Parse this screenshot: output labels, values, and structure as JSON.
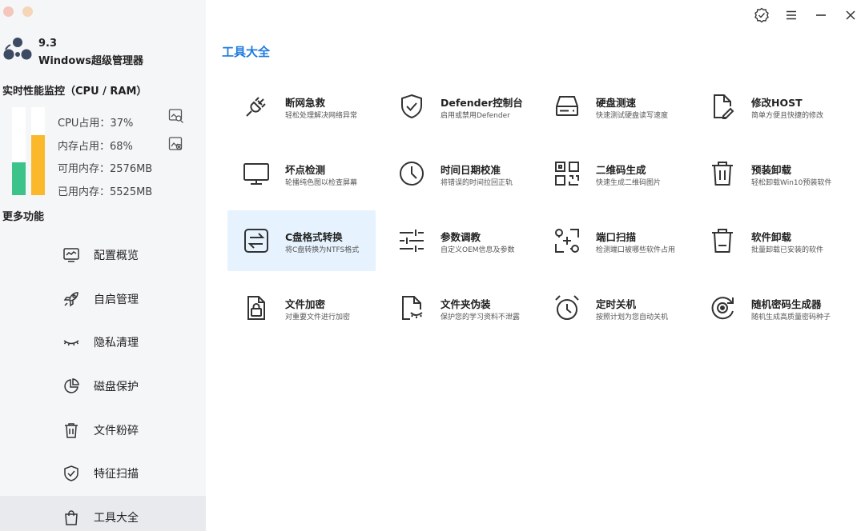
{
  "window": {
    "controls": [
      "verified-icon",
      "menu-icon",
      "minimize-icon",
      "close-icon"
    ]
  },
  "app": {
    "version": "9.3",
    "name": "Windows超级管理器"
  },
  "performance": {
    "title": "实时性能监控（CPU / RAM）",
    "cpu_percent": 37,
    "ram_percent": 68,
    "cpu_label": "CPU占用：37%",
    "ram_label": "内存占用：68%",
    "available_label": "可用内存：2576MB",
    "used_label": "已用内存：5525MB",
    "colors": {
      "cpu": "#3cc38a",
      "ram": "#fbb82a"
    }
  },
  "sidebar": {
    "more_title": "更多功能",
    "items": [
      {
        "label": "配置概览",
        "icon": "monitor-icon"
      },
      {
        "label": "自启管理",
        "icon": "rocket-icon"
      },
      {
        "label": "隐私清理",
        "icon": "eye-closed-icon"
      },
      {
        "label": "磁盘保护",
        "icon": "pie-chart-icon"
      },
      {
        "label": "文件粉碎",
        "icon": "trash-icon"
      },
      {
        "label": "特征扫描",
        "icon": "shield-check-icon"
      },
      {
        "label": "工具大全",
        "icon": "shopping-bag-icon",
        "active": true
      }
    ]
  },
  "main": {
    "title": "工具大全",
    "accent": "#1f7ae0",
    "tools": [
      {
        "title": "断网急救",
        "desc": "轻松处理解决网络异常",
        "icon": "plug-icon"
      },
      {
        "title": "Defender控制台",
        "desc": "启用或禁用Defender",
        "icon": "shield-check-icon"
      },
      {
        "title": "硬盘测速",
        "desc": "快速测试硬盘读写速度",
        "icon": "hard-drive-icon"
      },
      {
        "title": "修改HOST",
        "desc": "简单方便且快捷的修改",
        "icon": "file-edit-icon"
      },
      {
        "title": "坏点检测",
        "desc": "轮播纯色图以检查屏幕",
        "icon": "monitor-icon"
      },
      {
        "title": "时间日期校准",
        "desc": "将错误的时间拉回正轨",
        "icon": "clock-icon"
      },
      {
        "title": "二维码生成",
        "desc": "快速生成二维码图片",
        "icon": "qrcode-icon"
      },
      {
        "title": "预装卸载",
        "desc": "轻松卸载Win10预装软件",
        "icon": "trash-icon"
      },
      {
        "title": "C盘格式转换",
        "desc": "将C盘转换为NTFS格式",
        "icon": "convert-icon",
        "active": true
      },
      {
        "title": "参数调教",
        "desc": "自定义OEM信息及参数",
        "icon": "sliders-icon"
      },
      {
        "title": "端口扫描",
        "desc": "检测端口被哪些软件占用",
        "icon": "port-scan-icon"
      },
      {
        "title": "软件卸载",
        "desc": "批量卸载已安装的软件",
        "icon": "trash-minus-icon"
      },
      {
        "title": "文件加密",
        "desc": "对重要文件进行加密",
        "icon": "file-lock-icon"
      },
      {
        "title": "文件夹伪装",
        "desc": "保护您的学习资料不泄露",
        "icon": "file-hidden-icon"
      },
      {
        "title": "定时关机",
        "desc": "按照计划为您自动关机",
        "icon": "alarm-clock-icon"
      },
      {
        "title": "随机密码生成器",
        "desc": "随机生成高质量密码种子",
        "icon": "refresh-target-icon"
      }
    ]
  }
}
